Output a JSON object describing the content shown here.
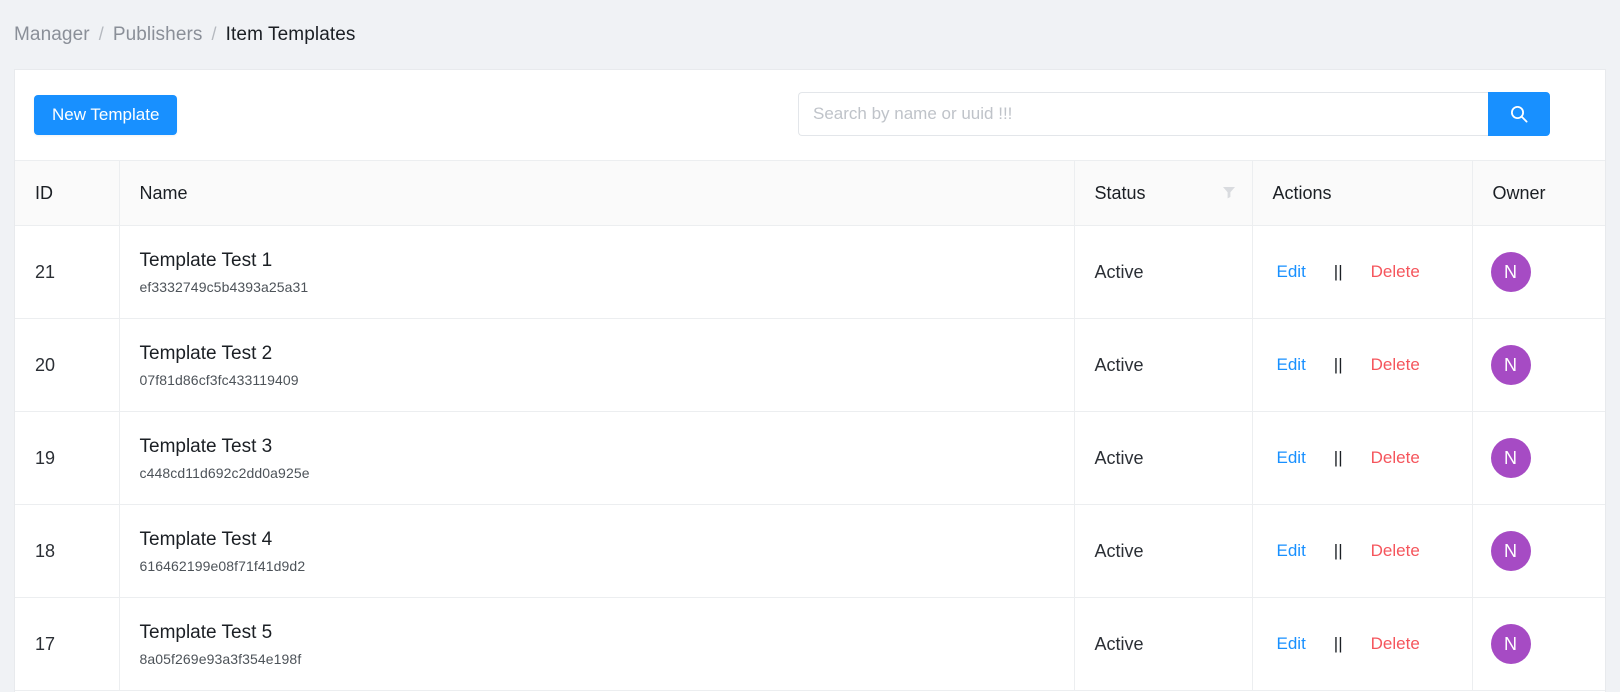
{
  "breadcrumb": {
    "items": [
      {
        "label": "Manager",
        "current": false
      },
      {
        "label": "Publishers",
        "current": false
      },
      {
        "label": "Item Templates",
        "current": true
      }
    ],
    "separator": "/"
  },
  "toolbar": {
    "new_template_label": "New Template",
    "search_placeholder": "Search by name or uuid !!!",
    "search_value": "",
    "search_icon": "search-icon"
  },
  "table": {
    "columns": [
      {
        "key": "id",
        "label": "ID"
      },
      {
        "key": "name",
        "label": "Name"
      },
      {
        "key": "status",
        "label": "Status",
        "icon": "filter-icon"
      },
      {
        "key": "actions",
        "label": "Actions"
      },
      {
        "key": "owner",
        "label": "Owner"
      }
    ],
    "rows": [
      {
        "id": "21",
        "name": "Template Test 1",
        "uuid": "ef3332749c5b4393a25a31",
        "status": "Active",
        "edit_label": "Edit",
        "separator": "||",
        "delete_label": "Delete",
        "owner_initial": "N"
      },
      {
        "id": "20",
        "name": "Template Test 2",
        "uuid": "07f81d86cf3fc433119409",
        "status": "Active",
        "edit_label": "Edit",
        "separator": "||",
        "delete_label": "Delete",
        "owner_initial": "N"
      },
      {
        "id": "19",
        "name": "Template Test 3",
        "uuid": "c448cd11d692c2dd0a925e",
        "status": "Active",
        "edit_label": "Edit",
        "separator": "||",
        "delete_label": "Delete",
        "owner_initial": "N"
      },
      {
        "id": "18",
        "name": "Template Test 4",
        "uuid": "616462199e08f71f41d9d2",
        "status": "Active",
        "edit_label": "Edit",
        "separator": "||",
        "delete_label": "Delete",
        "owner_initial": "N"
      },
      {
        "id": "17",
        "name": "Template Test 5",
        "uuid": "8a05f269e93a3f354e198f",
        "status": "Active",
        "edit_label": "Edit",
        "separator": "||",
        "delete_label": "Delete",
        "owner_initial": "N"
      }
    ]
  },
  "colors": {
    "primary": "#1890ff",
    "danger": "#f5555c",
    "avatar": "#a64bc4",
    "page_bg": "#f0f2f5",
    "header_bg": "#fafafa"
  }
}
